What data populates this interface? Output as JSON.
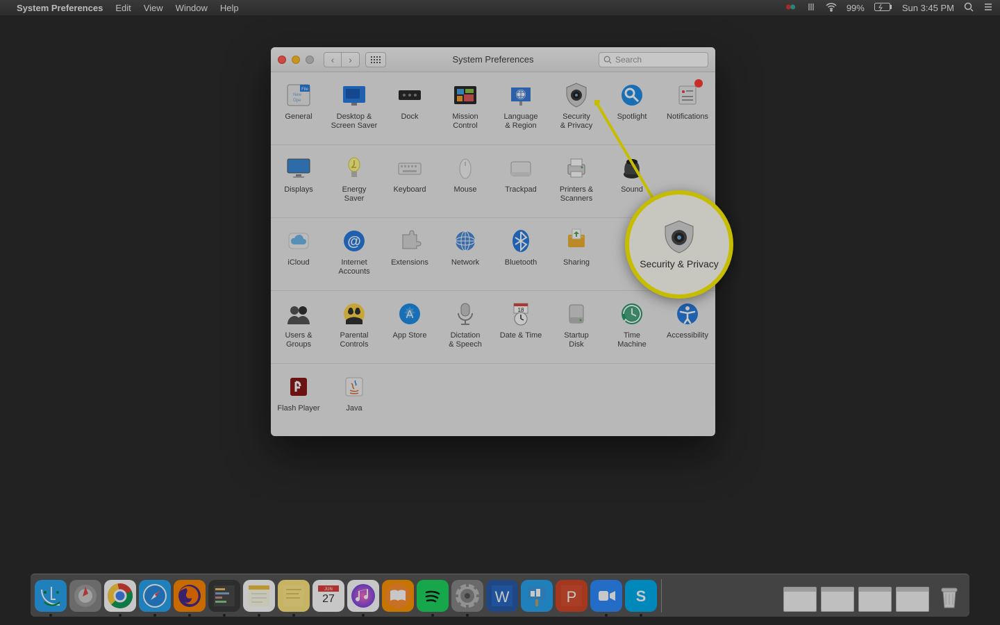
{
  "menubar": {
    "app": "System Preferences",
    "items": [
      "Edit",
      "View",
      "Window",
      "Help"
    ],
    "battery": "99%",
    "clock": "Sun 3:45 PM"
  },
  "window": {
    "title": "System Preferences",
    "search_placeholder": "Search"
  },
  "rows": [
    [
      {
        "id": "general",
        "label": "General",
        "icon": "general"
      },
      {
        "id": "desktop",
        "label": "Desktop &\nScreen Saver",
        "icon": "desktop"
      },
      {
        "id": "dock",
        "label": "Dock",
        "icon": "dock"
      },
      {
        "id": "mission",
        "label": "Mission\nControl",
        "icon": "mission"
      },
      {
        "id": "language",
        "label": "Language\n& Region",
        "icon": "language"
      },
      {
        "id": "security",
        "label": "Security\n& Privacy",
        "icon": "security"
      },
      {
        "id": "spotlight",
        "label": "Spotlight",
        "icon": "spotlight"
      },
      {
        "id": "notifications",
        "label": "Notifications",
        "icon": "notifications",
        "badge": true
      }
    ],
    [
      {
        "id": "displays",
        "label": "Displays",
        "icon": "displays"
      },
      {
        "id": "energy",
        "label": "Energy\nSaver",
        "icon": "energy"
      },
      {
        "id": "keyboard",
        "label": "Keyboard",
        "icon": "keyboard"
      },
      {
        "id": "mouse",
        "label": "Mouse",
        "icon": "mouse"
      },
      {
        "id": "trackpad",
        "label": "Trackpad",
        "icon": "trackpad"
      },
      {
        "id": "printers",
        "label": "Printers &\nScanners",
        "icon": "printer"
      },
      {
        "id": "sound",
        "label": "Sound",
        "icon": "sound"
      }
    ],
    [
      {
        "id": "icloud",
        "label": "iCloud",
        "icon": "icloud"
      },
      {
        "id": "internet",
        "label": "Internet\nAccounts",
        "icon": "at"
      },
      {
        "id": "extensions",
        "label": "Extensions",
        "icon": "puzzle"
      },
      {
        "id": "network",
        "label": "Network",
        "icon": "network"
      },
      {
        "id": "bluetooth",
        "label": "Bluetooth",
        "icon": "bluetooth"
      },
      {
        "id": "sharing",
        "label": "Sharing",
        "icon": "sharing"
      }
    ],
    [
      {
        "id": "users",
        "label": "Users &\nGroups",
        "icon": "users"
      },
      {
        "id": "parental",
        "label": "Parental\nControls",
        "icon": "parental"
      },
      {
        "id": "appstore",
        "label": "App Store",
        "icon": "appstore"
      },
      {
        "id": "dictation",
        "label": "Dictation\n& Speech",
        "icon": "mic"
      },
      {
        "id": "datetime",
        "label": "Date & Time",
        "icon": "clock"
      },
      {
        "id": "startup",
        "label": "Startup\nDisk",
        "icon": "disk"
      },
      {
        "id": "timemachine",
        "label": "Time\nMachine",
        "icon": "timemachine"
      },
      {
        "id": "accessibility",
        "label": "Accessibility",
        "icon": "accessibility"
      }
    ],
    [
      {
        "id": "flash",
        "label": "Flash Player",
        "icon": "flash"
      },
      {
        "id": "java",
        "label": "Java",
        "icon": "java"
      }
    ]
  ],
  "callout": {
    "label": "Security\n& Privacy"
  },
  "dock": {
    "apps": [
      "finder",
      "launchpad",
      "chrome",
      "safari",
      "firefox",
      "sublime",
      "notes",
      "stickies",
      "calendar",
      "itunes",
      "ibooks",
      "spotify",
      "sysprefs",
      "word",
      "keynote",
      "powerpoint",
      "zoom",
      "skype"
    ],
    "running": [
      "finder",
      "chrome",
      "safari",
      "firefox",
      "sublime",
      "notes",
      "stickies",
      "itunes",
      "spotify",
      "sysprefs",
      "zoom",
      "skype"
    ],
    "minimized_count": 4,
    "calendar_day": "27",
    "calendar_month": "JUN"
  }
}
